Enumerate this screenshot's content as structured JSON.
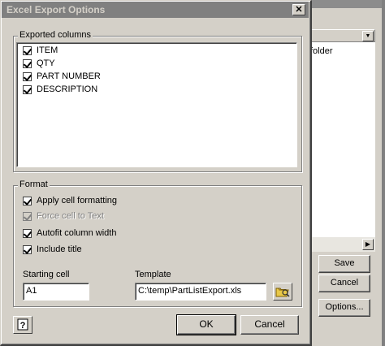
{
  "background_window": {
    "folder_text": "folder",
    "buttons": {
      "save": "Save",
      "cancel": "Cancel",
      "options": "Options..."
    }
  },
  "dialog": {
    "title": "Excel Export Options",
    "exported_columns": {
      "label": "Exported columns",
      "items": [
        {
          "label": "ITEM",
          "checked": true
        },
        {
          "label": "QTY",
          "checked": true
        },
        {
          "label": "PART NUMBER",
          "checked": true
        },
        {
          "label": "DESCRIPTION",
          "checked": true
        }
      ]
    },
    "format": {
      "label": "Format",
      "options": [
        {
          "label": "Apply cell formatting",
          "checked": true,
          "enabled": true
        },
        {
          "label": "Force cell to Text",
          "checked": true,
          "enabled": false
        },
        {
          "label": "Autofit column width",
          "checked": true,
          "enabled": true
        },
        {
          "label": "Include title",
          "checked": true,
          "enabled": true
        }
      ]
    },
    "starting_cell": {
      "label": "Starting cell",
      "value": "A1"
    },
    "template": {
      "label": "Template",
      "value": "C:\\temp\\PartListExport.xls"
    },
    "buttons": {
      "ok": "OK",
      "cancel": "Cancel"
    },
    "icons": {
      "help": "help-icon",
      "browse": "folder-open-icon",
      "close": "close-icon"
    }
  }
}
